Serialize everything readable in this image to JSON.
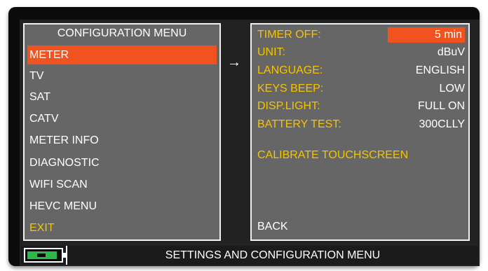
{
  "left_panel": {
    "title": "CONFIGURATION MENU",
    "items": [
      {
        "label": "METER",
        "selected": true
      },
      {
        "label": "TV"
      },
      {
        "label": "SAT"
      },
      {
        "label": "CATV"
      },
      {
        "label": "METER INFO"
      },
      {
        "label": "DIAGNOSTIC"
      },
      {
        "label": "WIFI SCAN"
      },
      {
        "label": "HEVC MENU"
      },
      {
        "label": "EXIT"
      }
    ]
  },
  "pointer_arrow": "→",
  "right_panel": {
    "settings": [
      {
        "label": "TIMER OFF:",
        "value": "5 min",
        "highlighted": true
      },
      {
        "label": "UNIT:",
        "value": "dBuV"
      },
      {
        "label": "LANGUAGE:",
        "value": "ENGLISH"
      },
      {
        "label": "KEYS BEEP:",
        "value": "LOW"
      },
      {
        "label": "DISP.LIGHT:",
        "value": "FULL ON"
      },
      {
        "label": "BATTERY TEST:",
        "value": "300CLLY"
      }
    ],
    "calibrate_label": "CALIBRATE TOUCHSCREEN",
    "back_label": "BACK"
  },
  "status_bar": {
    "battery_icon": "battery-icon",
    "text": "SETTINGS AND CONFIGURATION MENU"
  },
  "colors": {
    "selection": "#f0531f",
    "label_yellow": "#f5c400",
    "panel_bg": "#666666",
    "battery_green": "#2db84a"
  }
}
